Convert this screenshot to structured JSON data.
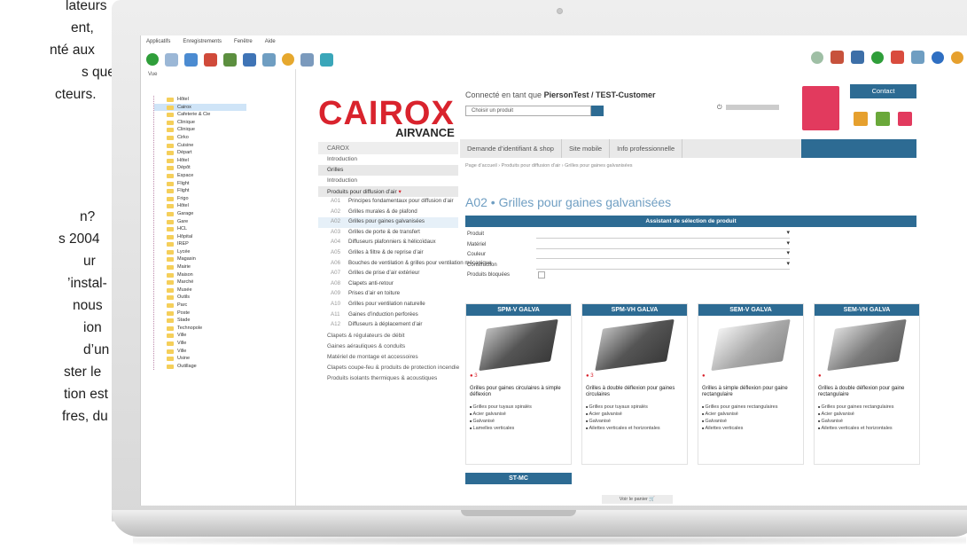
{
  "article": {
    "l1": "lateurs",
    "l2": "ent,",
    "l3": "nté aux",
    "l4": "s que",
    "l5": "cteurs.",
    "l6": "n?",
    "l7": "s 2004",
    "l8": "ur",
    "l9": "’instal-",
    "l10": "nous",
    "l11": "ion",
    "l12": "d’un",
    "l13": "ster le",
    "l14": "tion est",
    "l15": "fres, du",
    "l16": ""
  },
  "app": {
    "menu": [
      "Applicatifs",
      "Enregistrements",
      "Fenêtre",
      "Aide"
    ]
  },
  "tree": {
    "header": "Vue",
    "items": [
      "Hôtel",
      "Cairox",
      "Cafeterie & Cie",
      "Clinique",
      "Clinique",
      "Cirko",
      "Cuisine",
      "Départ",
      "Hôtel",
      "Dépôt",
      "Espace",
      "Flight",
      "Flight",
      "Frigo",
      "Hôtel",
      "Garage",
      "Gare",
      "HCL",
      "Hôpital",
      "IREP",
      "Lycée",
      "Magasin",
      "Mairie",
      "Maison",
      "Marché",
      "Musée",
      "Outils",
      "Parc",
      "Poste",
      "Stade",
      "Technopole",
      "Ville",
      "Ville",
      "Ville",
      "Usine",
      "Outillage"
    ],
    "selected": 1
  },
  "site": {
    "logo": "CAIROX",
    "logo_sub": "AIRVANCE",
    "connected_prefix": "Connecté en tant que",
    "connected_user": "PiersonTest / TEST-Customer",
    "choice_placeholder": "Choisir un produit",
    "contact": "Contact",
    "see_more": "Voir le panier"
  },
  "nav": {
    "title": "CAROX",
    "items": [
      "Introduction",
      "Grilles",
      "Introduction",
      "Produits pour diffusion d’air",
      "Clapets & régulateurs de débit",
      "Gaines aérauliques & conduits",
      "Matériel de montage et accessoires",
      "Clapets coupe-feu & produits de protection incendie",
      "Produits isolants thermiques & acoustiques"
    ],
    "sub": [
      {
        "code": "A01",
        "label": "Principes fondamentaux pour diffusion d’air"
      },
      {
        "code": "A02",
        "label": "Grilles murales & de plafond"
      },
      {
        "code": "A02",
        "label": "Grilles pour gaines galvanisées"
      },
      {
        "code": "A03",
        "label": "Grilles de porte & de transfert"
      },
      {
        "code": "A04",
        "label": "Diffuseurs plafonniers & hélicoïdaux"
      },
      {
        "code": "A05",
        "label": "Grilles à filtre & de reprise d’air"
      },
      {
        "code": "A06",
        "label": "Bouches de ventilation & grilles pour ventilation mécanique"
      },
      {
        "code": "A07",
        "label": "Grilles de prise d’air extérieur"
      },
      {
        "code": "A08",
        "label": "Clapets anti-retour"
      },
      {
        "code": "A09",
        "label": "Prises d’air en toiture"
      },
      {
        "code": "A10",
        "label": "Grilles pour ventilation naturelle"
      },
      {
        "code": "A11",
        "label": "Gaines d’induction perforées"
      },
      {
        "code": "A12",
        "label": "Diffuseurs à déplacement d’air"
      }
    ],
    "sub_highlight": 2
  },
  "tabs": [
    "Demande d’identifiant & shop",
    "Site mobile",
    "Info professionnelle"
  ],
  "breadcrumb": "Page d’accueil › Produits pour diffusion d’air › Grilles pour gaines galvanisées",
  "page": {
    "title": "A02 • Grilles pour gaines galvanisées"
  },
  "assistant": {
    "title": "Assistant de sélection de produit",
    "fields": [
      "Produit",
      "Matériel",
      "Couleur",
      "Construction",
      "Produits bloquées"
    ]
  },
  "products": [
    {
      "name": "SPM-V GALVA",
      "rating": "● 3",
      "desc": "Grilles pour gaines circulaires à simple déflexion",
      "features": [
        "Grilles pour tuyaux spiralés",
        "Acier galvanisé",
        "Galvanisé",
        "Lamelles verticales"
      ]
    },
    {
      "name": "SPM-VH GALVA",
      "rating": "● 3",
      "desc": "Grilles à double déflexion pour gaines circulaires",
      "features": [
        "Grilles pour tuyaux spiralés",
        "Acier galvanisé",
        "Galvanisé",
        "Ailettes verticales et horizontales"
      ]
    },
    {
      "name": "SEM-V GALVA",
      "rating": "●",
      "desc": "Grilles à simple déflexion pour gaine rectangulaire",
      "features": [
        "Grilles pour gaines rectangulaires",
        "Acier galvanisé",
        "Galvanisé",
        "Ailettes verticales"
      ]
    },
    {
      "name": "SEM-VH GALVA",
      "rating": "●",
      "desc": "Grilles à double déflexion pour gaine rectangulaire",
      "features": [
        "Grilles pour gaines rectangulaires",
        "Acier galvanisé",
        "Galvanisé",
        "Ailettes verticales et horizontales"
      ]
    },
    {
      "name": "ST-MC"
    }
  ]
}
